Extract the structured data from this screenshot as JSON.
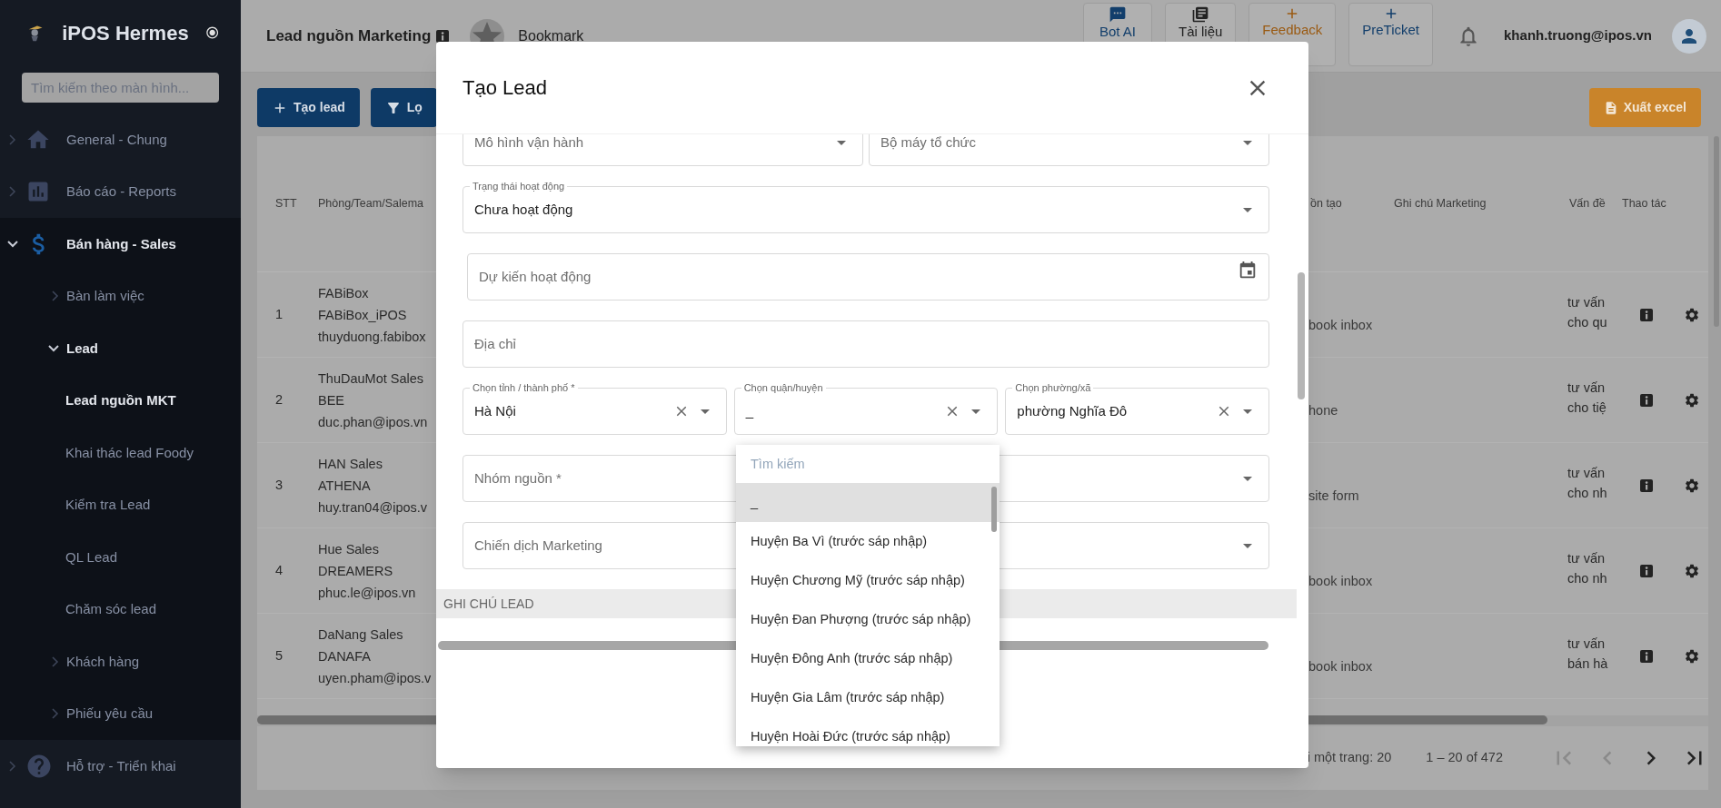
{
  "sidebar": {
    "brand": "iPOS Hermes",
    "search_placeholder": "Tìm kiếm theo màn hình...",
    "items": [
      {
        "label": "General - Chung",
        "expanded": false
      },
      {
        "label": "Báo cáo - Reports",
        "expanded": false
      },
      {
        "label": "Bán hàng - Sales",
        "expanded": true,
        "children": [
          {
            "label": "Bàn làm việc",
            "expanded": false
          },
          {
            "label": "Lead",
            "expanded": true,
            "children": [
              {
                "label": "Lead nguồn MKT",
                "selected": true
              },
              {
                "label": "Khai thác lead Foody",
                "selected": false
              },
              {
                "label": "Kiểm tra Lead",
                "selected": false
              },
              {
                "label": "QL Lead",
                "selected": false
              },
              {
                "label": "Chăm sóc lead",
                "selected": false
              }
            ]
          },
          {
            "label": "Khách hàng",
            "expanded": false
          },
          {
            "label": "Phiếu yêu cầu",
            "expanded": false
          }
        ]
      },
      {
        "label": "Hỗ trợ - Triển khai",
        "expanded": false
      }
    ]
  },
  "header": {
    "title": "Lead nguồn Marketing",
    "bookmark": "Bookmark",
    "actions": [
      {
        "label": "Bot AI",
        "color": "#123e6b"
      },
      {
        "label": "Tài liệu",
        "color": "#222222"
      },
      {
        "label": "Feedback",
        "color": "#9a5a12"
      },
      {
        "label": "PreTicket",
        "color": "#123e6b"
      }
    ],
    "user_email": "khanh.truong@ipos.vn"
  },
  "toolbar": {
    "buttons": [
      {
        "label": "Tạo lead",
        "kind": "create"
      },
      {
        "label": "Lọ",
        "kind": "filter"
      }
    ],
    "export_button": "Xuất excel"
  },
  "table": {
    "columns": [
      "STT",
      "Phòng/Team/Salema",
      "ồn tạo",
      "Ghi chú Marketing",
      "Vấn đề",
      "Thao tác"
    ],
    "rows": [
      {
        "stt": "1",
        "team": [
          "FABiBox",
          "FABiBox_iPOS",
          "thuyduong.fabibox"
        ],
        "source": "book inbox",
        "issue": [
          "tư vấn",
          "cho qu"
        ]
      },
      {
        "stt": "2",
        "team": [
          "ThuDauMot Sales",
          "BEE",
          "duc.phan@ipos.vn"
        ],
        "source": "hone",
        "issue": [
          "tư vấn",
          "cho tiệ"
        ]
      },
      {
        "stt": "3",
        "team": [
          "HAN Sales",
          "ATHENA",
          "huy.tran04@ipos.v"
        ],
        "source": "site form",
        "issue": [
          "tư vấn",
          "cho nh"
        ]
      },
      {
        "stt": "4",
        "team": [
          "Hue Sales",
          "DREAMERS",
          "phuc.le@ipos.vn"
        ],
        "source": "book inbox",
        "issue": [
          "tư vấn",
          "cho nh"
        ]
      },
      {
        "stt": "5",
        "team": [
          "DaNang Sales",
          "DANAFA",
          "uyen.pham@ipos.v"
        ],
        "source": "book inbox",
        "issue": [
          "tư vấn",
          "bán hà"
        ]
      }
    ],
    "footer": {
      "rows_per_page": "i một trang: 20",
      "range": "1 – 20 of 472",
      "pager": [
        {
          "kind": "first",
          "disabled": true
        },
        {
          "kind": "prev",
          "disabled": true
        },
        {
          "kind": "next",
          "disabled": false
        },
        {
          "kind": "last",
          "disabled": false
        }
      ]
    }
  },
  "modal": {
    "title": "Tạo Lead",
    "rows": [
      [
        {
          "kind": "select",
          "label": "Mô hình vận hành"
        },
        {
          "kind": "select",
          "label": "Bộ máy tổ chức"
        }
      ],
      [
        {
          "kind": "select",
          "label": "Trạng thái hoạt động",
          "value": "Chưa hoạt động"
        }
      ],
      [
        {
          "kind": "date",
          "label": "Dự kiến hoạt động"
        }
      ],
      [
        {
          "kind": "text",
          "label": "Địa chỉ"
        }
      ],
      [
        {
          "kind": "select",
          "label": "Chọn tỉnh / thành phố *",
          "value": "Hà Nội",
          "clearable": true
        },
        {
          "kind": "select",
          "label": "Chọn quận/huyện",
          "value": "_",
          "clearable": true
        },
        {
          "kind": "select",
          "label": "Chọn phường/xã",
          "value": "phường Nghĩa Đô",
          "clearable": true
        }
      ],
      [
        {
          "kind": "select",
          "label": "Nhóm nguồn *"
        },
        {
          "kind": "select"
        }
      ],
      [
        {
          "kind": "select",
          "label": "Chiến dịch Marketing"
        },
        {
          "kind": "select"
        }
      ]
    ],
    "section": "GHI CHÚ LEAD",
    "dropdown": {
      "search_placeholder": "Tìm kiếm",
      "options": [
        {
          "label": "_",
          "selected": true
        },
        {
          "label": "Huyện Ba Vì (trước sáp nhập)",
          "selected": false
        },
        {
          "label": "Huyện Chương Mỹ (trước sáp nhập)",
          "selected": false
        },
        {
          "label": "Huyện Đan Phượng (trước sáp nhập)",
          "selected": false
        },
        {
          "label": "Huyện Đông Anh (trước sáp nhập)",
          "selected": false
        },
        {
          "label": "Huyện Gia Lâm (trước sáp nhập)",
          "selected": false
        },
        {
          "label": "Huyện Hoài Đức (trước sáp nhập)",
          "selected": false
        }
      ]
    }
  }
}
